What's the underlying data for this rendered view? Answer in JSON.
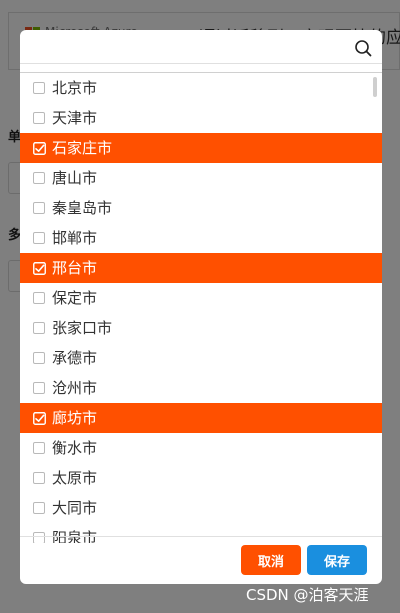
{
  "background": {
    "brand_text": "Microsoft Azure",
    "headline": "通过迁移到云实现更快的应用",
    "label_single": "单",
    "label_multi": "多",
    "ms_logo_colors": [
      "#f25022",
      "#7fba00",
      "#00a4ef",
      "#ffb900"
    ]
  },
  "modal": {
    "search": {
      "placeholder": "",
      "value": "",
      "icon": "search-icon"
    },
    "items": [
      {
        "label": "北京市",
        "selected": false
      },
      {
        "label": "天津市",
        "selected": false
      },
      {
        "label": "石家庄市",
        "selected": true
      },
      {
        "label": "唐山市",
        "selected": false
      },
      {
        "label": "秦皇岛市",
        "selected": false
      },
      {
        "label": "邯郸市",
        "selected": false
      },
      {
        "label": "邢台市",
        "selected": true
      },
      {
        "label": "保定市",
        "selected": false
      },
      {
        "label": "张家口市",
        "selected": false
      },
      {
        "label": "承德市",
        "selected": false
      },
      {
        "label": "沧州市",
        "selected": false
      },
      {
        "label": "廊坊市",
        "selected": true
      },
      {
        "label": "衡水市",
        "selected": false
      },
      {
        "label": "太原市",
        "selected": false
      },
      {
        "label": "大同市",
        "selected": false
      },
      {
        "label": "阳泉市",
        "selected": false
      }
    ],
    "buttons": {
      "cancel_label": "取消",
      "save_label": "保存"
    }
  },
  "colors": {
    "selected_bg": "#ff5000",
    "cancel_bg": "#ff5000",
    "save_bg": "#1a8fdf"
  },
  "watermark": "CSDN @泊客天涯"
}
